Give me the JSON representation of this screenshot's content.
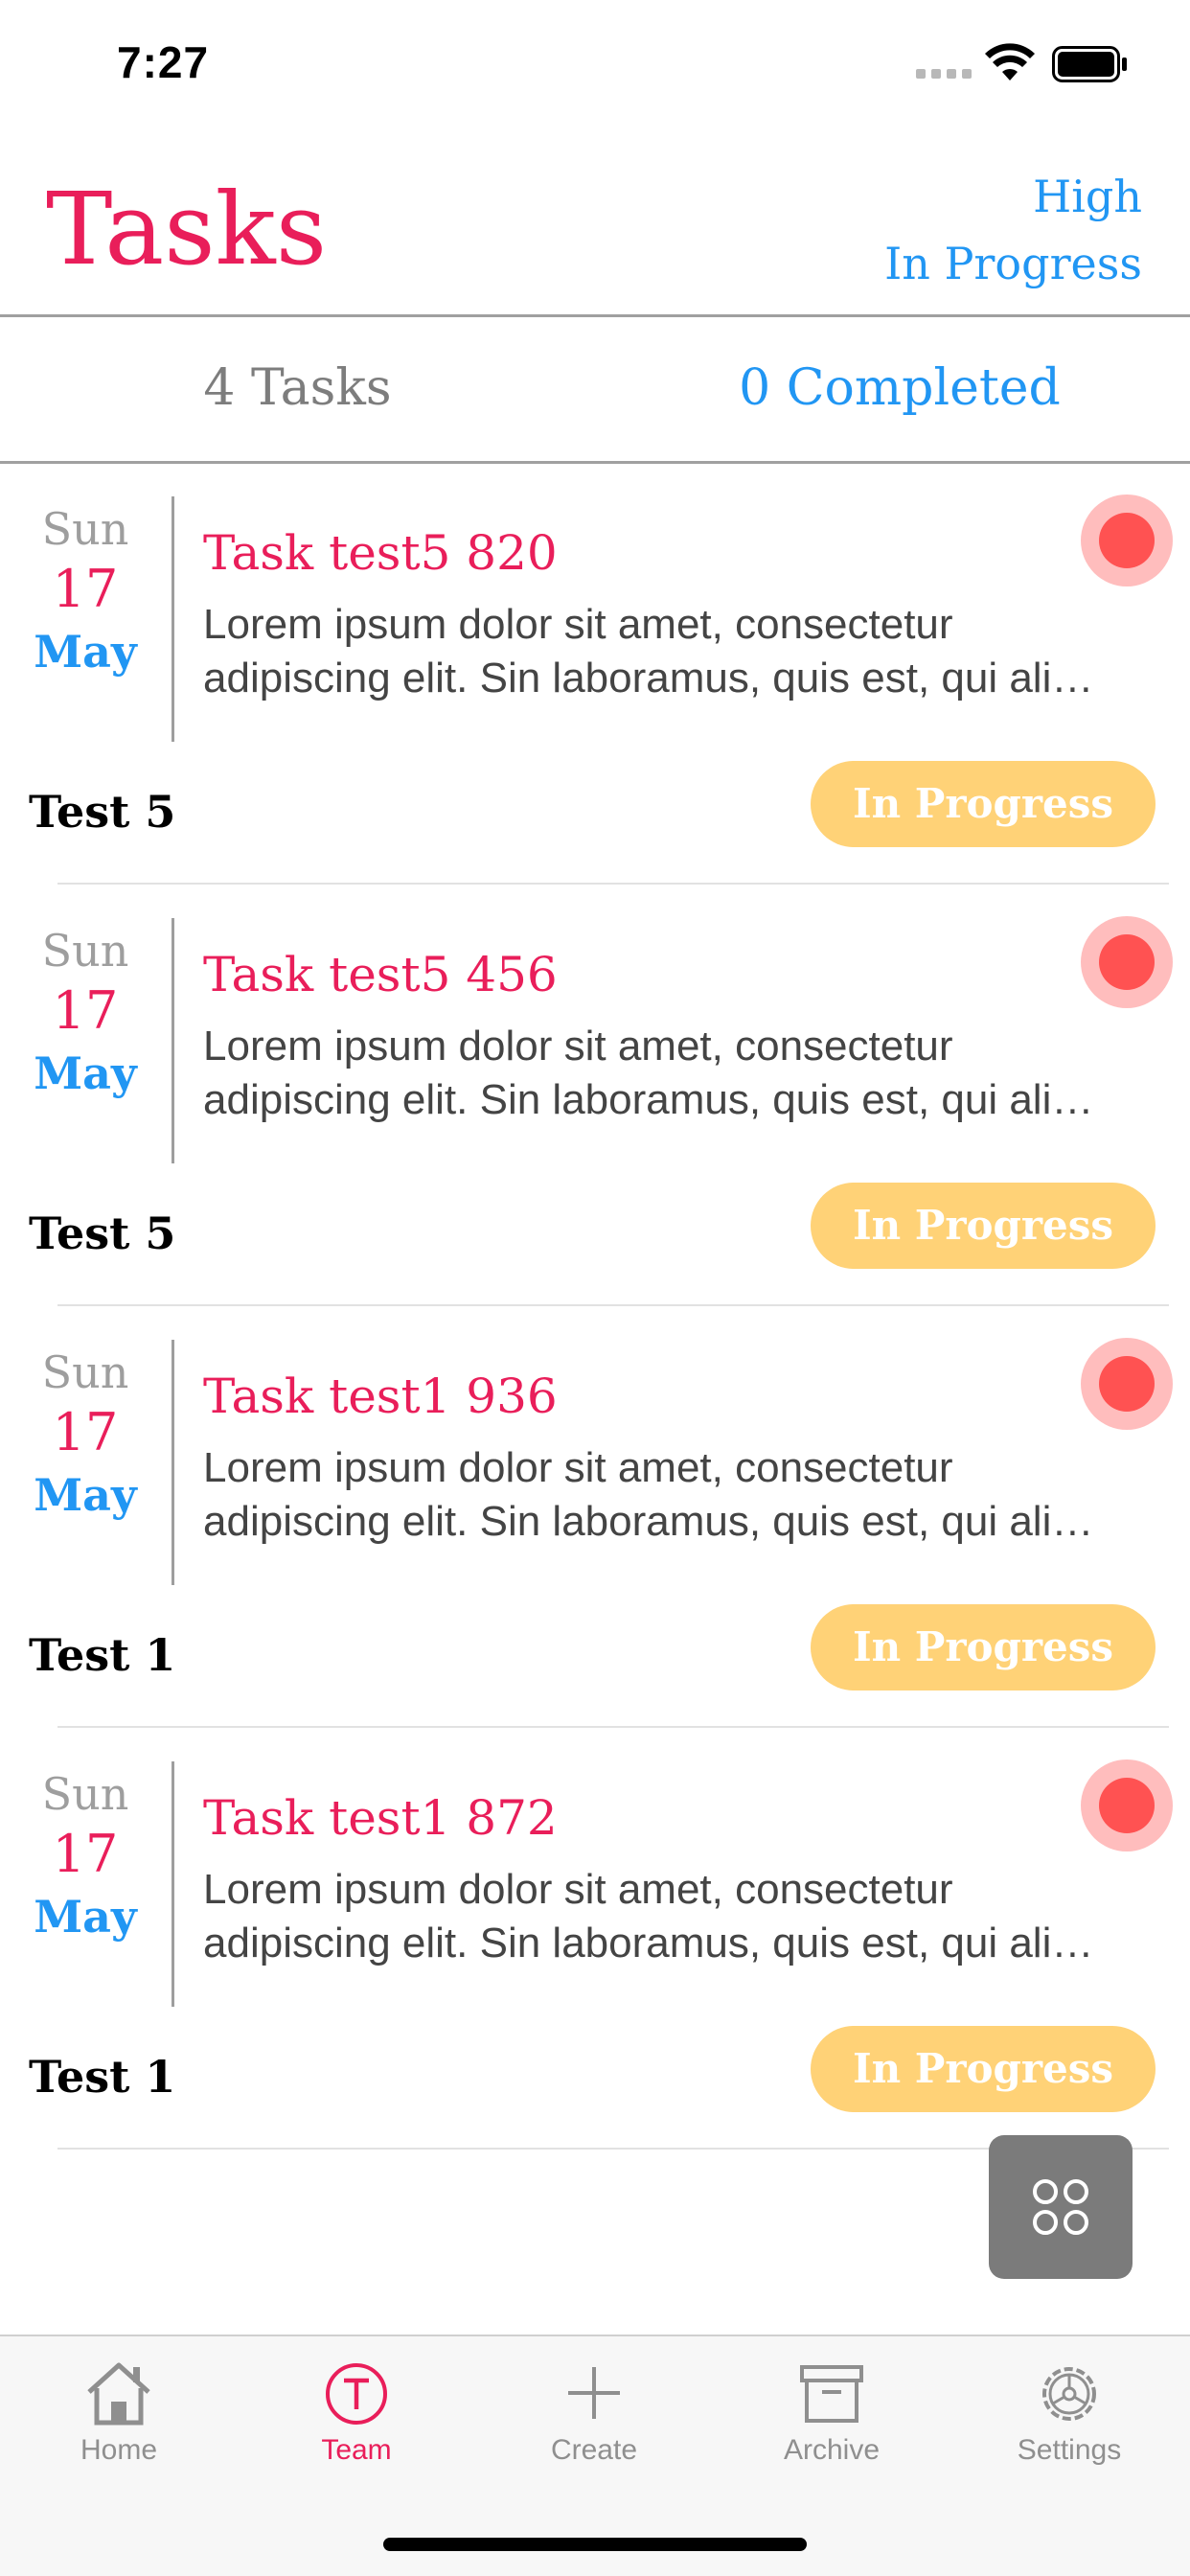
{
  "status_bar": {
    "time": "7:27"
  },
  "header": {
    "title": "Tasks",
    "filter_priority": "High",
    "filter_status": "In Progress"
  },
  "summary": {
    "tasks_label": "4 Tasks",
    "completed_label": "0 Completed"
  },
  "tasks": [
    {
      "dow": "Sun",
      "day": "17",
      "month": "May",
      "title": "Task test5 820",
      "desc_line1": "Lorem ipsum dolor sit amet, consectetur",
      "desc_line2": "adipiscing elit. Sin laboramus, quis est, qui ali…",
      "team": "Test 5",
      "status": "In Progress",
      "priority": "high"
    },
    {
      "dow": "Sun",
      "day": "17",
      "month": "May",
      "title": "Task test5 456",
      "desc_line1": "Lorem ipsum dolor sit amet, consectetur",
      "desc_line2": "adipiscing elit. Sin laboramus, quis est, qui ali…",
      "team": "Test 5",
      "status": "In Progress",
      "priority": "high"
    },
    {
      "dow": "Sun",
      "day": "17",
      "month": "May",
      "title": "Task test1 936",
      "desc_line1": "Lorem ipsum dolor sit amet, consectetur",
      "desc_line2": "adipiscing elit. Sin laboramus, quis est, qui ali…",
      "team": "Test 1",
      "status": "In Progress",
      "priority": "high"
    },
    {
      "dow": "Sun",
      "day": "17",
      "month": "May",
      "title": "Task test1 872",
      "desc_line1": "Lorem ipsum dolor sit amet, consectetur",
      "desc_line2": "adipiscing elit. Sin laboramus, quis est, qui ali…",
      "team": "Test 1",
      "status": "In Progress",
      "priority": "high"
    }
  ],
  "fab": {
    "icon": "grid-icon"
  },
  "tab_bar": {
    "items": [
      {
        "label": "Home",
        "icon": "home-icon"
      },
      {
        "label": "Team",
        "icon": "team-icon"
      },
      {
        "label": "Create",
        "icon": "plus-icon"
      },
      {
        "label": "Archive",
        "icon": "archive-icon"
      },
      {
        "label": "Settings",
        "icon": "settings-icon"
      }
    ],
    "active": "Team"
  },
  "colors": {
    "accent_pink": "#e91e5a",
    "accent_blue": "#2196f3",
    "status_pill": "#ffd277",
    "priority_red": "#ff5252"
  }
}
